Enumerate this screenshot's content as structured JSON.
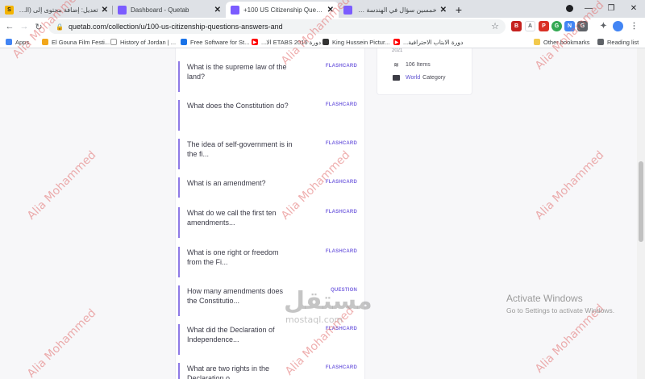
{
  "browser": {
    "tabs": [
      {
        "title": "تعديل: إضافة محتوى إلى (الووردبر...",
        "favicon_color": "#f4b400",
        "favicon_text": "S",
        "active": false
      },
      {
        "title": "Dashboard - Quetab",
        "favicon_color": "#7b5cff",
        "favicon_text": "",
        "active": false
      },
      {
        "title": "+100 US Citizenship Questions",
        "favicon_color": "#7b5cff",
        "favicon_text": "",
        "active": true
      },
      {
        "title": "خمسين سؤال في الهندسة المدنية",
        "favicon_color": "#7b5cff",
        "favicon_text": "",
        "active": false
      }
    ],
    "url": "quetab.com/collection/u/100-us-citizenship-questions-answers-and",
    "bookmarks": [
      {
        "label": "Apps",
        "icon_color": "#4285f4"
      },
      {
        "label": "El Gouna Film Festi...",
        "icon_color": "#f2a71b"
      },
      {
        "label": "History of Jordan | ...",
        "icon_color": "#ffffff"
      },
      {
        "label": "Free Software for St...",
        "icon_color": "#1a73e8"
      },
      {
        "label": "دورة ETABS 2016 الا...",
        "icon_color": "#ff0000"
      },
      {
        "label": "King Hussein Pictur...",
        "icon_color": "#333333"
      },
      {
        "label": "دورة الابتاب الاحترافية...",
        "icon_color": "#ff0000"
      },
      {
        "label": "Other bookmarks",
        "icon_color": "#f2c94c"
      },
      {
        "label": "Reading list",
        "icon_color": "#5f6368"
      }
    ]
  },
  "collection_info": {
    "year": "2021",
    "items_count": "106 Items",
    "category_link": "World",
    "category_label": "Category"
  },
  "questions": [
    {
      "text": "What is the supreme law of the land?",
      "kind": "FLASHCARD"
    },
    {
      "text": "What does the Constitution do?",
      "kind": "FLASHCARD"
    },
    {
      "text": "The idea of self-government is in the fi...",
      "kind": "FLASHCARD"
    },
    {
      "text": "What is an amendment?",
      "kind": "FLASHCARD"
    },
    {
      "text": "What do we call the first ten amendments...",
      "kind": "FLASHCARD"
    },
    {
      "text": "What is one right or freedom from the Fi...",
      "kind": "FLASHCARD"
    },
    {
      "text": "How many amendments does the Constitutio...",
      "kind": "QUESTION"
    },
    {
      "text": "What did the Declaration of Independence...",
      "kind": "FLASHCARD"
    },
    {
      "text": "What are two rights in the Declaration o...",
      "kind": "FLASHCARD"
    }
  ],
  "overlay": {
    "watermark": "Alia Mohammed",
    "activate_title": "Activate Windows",
    "activate_sub": "Go to Settings to activate Windows.",
    "mostaql_arabic": "مستقل",
    "mostaql_domain": "mostaql.com"
  },
  "colors": {
    "accent": "#7a67e0",
    "card_border": "#8e7ae6",
    "watermark": "#e26e6e"
  }
}
